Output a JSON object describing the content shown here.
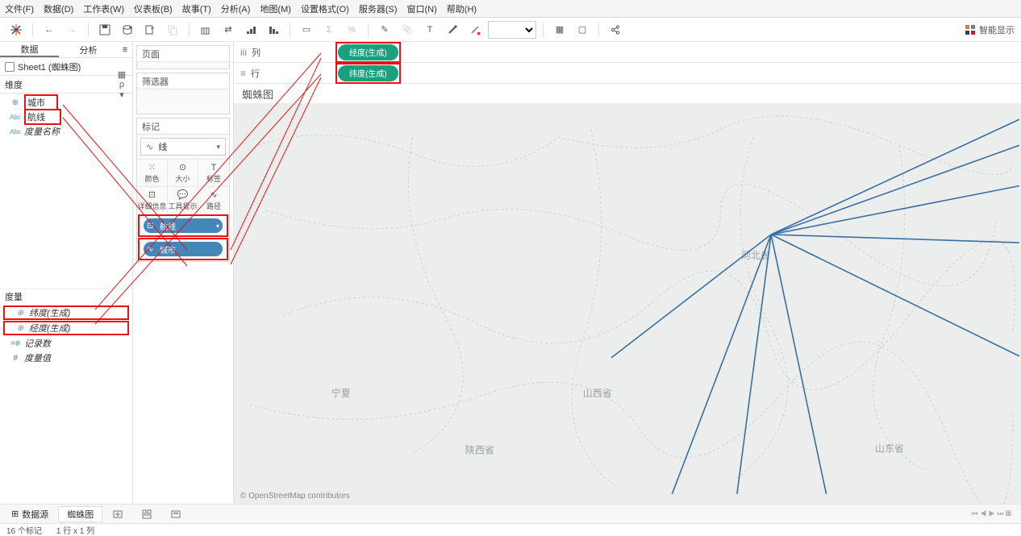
{
  "menu": {
    "file": "文件(F)",
    "data": "数据(D)",
    "worksheet": "工作表(W)",
    "dashboard": "仪表板(B)",
    "story": "故事(T)",
    "analysis": "分析(A)",
    "map": "地图(M)",
    "format": "设置格式(O)",
    "server": "服务器(S)",
    "window": "窗口(N)",
    "help": "帮助(H)"
  },
  "toolbar": {
    "smart_show": "智能显示"
  },
  "data_pane": {
    "tab_data": "数据",
    "tab_analytics": "分析",
    "datasource": "Sheet1 (蜘蛛图)",
    "dimensions_label": "维度",
    "measures_label": "度量",
    "view_opts": "▦ ρ ▾",
    "dimensions": {
      "city": "城市",
      "route": "航线",
      "measure_names": "度量名称"
    },
    "measures": {
      "lat": "纬度(生成)",
      "lng": "经度(生成)",
      "record_count": "记录数",
      "measure_values": "度量值"
    }
  },
  "cards": {
    "pages": "页面",
    "filters": "筛选器",
    "marks": "标记",
    "mark_type": "线",
    "grid": {
      "color": "颜色",
      "size": "大小",
      "label": "标签",
      "detail": "详细信息",
      "tooltip": "工具提示",
      "path": "路径"
    },
    "encodings": {
      "route": "航线",
      "city": "城市"
    }
  },
  "shelves": {
    "columns_label": "列",
    "rows_label": "行",
    "columns_pill": "经度(生成)",
    "rows_pill": "纬度(生成)"
  },
  "viz": {
    "title": "蜘蛛图",
    "attribution": "© OpenStreetMap contributors",
    "region_labels": {
      "ningxia": "宁夏",
      "shanxi": "山西省",
      "shaanxi": "陕西省",
      "hebei": "河北省",
      "shandong": "山东省"
    }
  },
  "bottom": {
    "datasource": "数据源",
    "sheet_name": "蜘蛛图"
  },
  "status": {
    "marks": "16 个标记",
    "rows_cols": "1 行 x 1 列"
  }
}
